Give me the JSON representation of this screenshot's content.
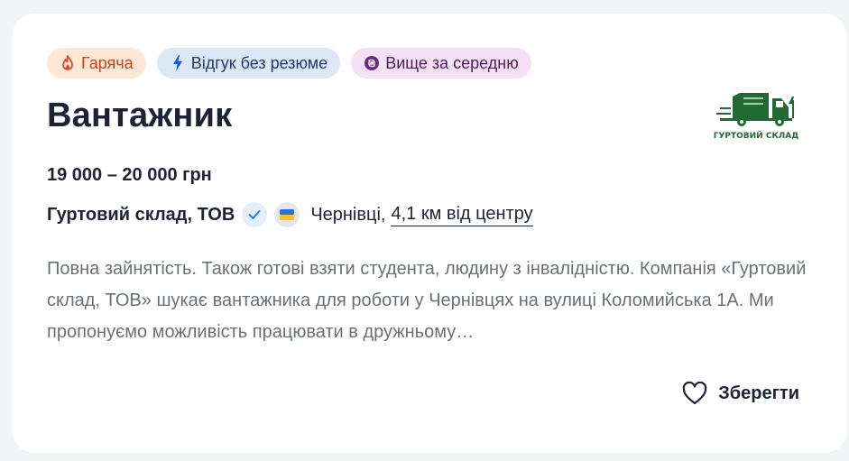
{
  "tags": [
    {
      "label": "Гаряча",
      "icon": "flame-icon"
    },
    {
      "label": "Відгук без резюме",
      "icon": "lightning-icon"
    },
    {
      "label": "Вище за середню",
      "icon": "hryvnia-coin-icon"
    }
  ],
  "vacancy": {
    "title": "Вантажник",
    "salary": "19 000 – 20 000 грн",
    "company": "Гуртовий склад, ТОВ",
    "city": "Чернівці,",
    "distance": "4,1 км від центру",
    "description": "Повна зайнятість. Також готові взяти студента, людину з інвалідністю. Компанія «Гуртовий склад, ТОВ» шукає вантажника для роботи у Чернівцях на вулиці Коломийська 1А. Ми пропонуємо можливість працювати в дружньому…"
  },
  "logo": {
    "text": "ГУРТОВИЙ СКЛАД",
    "color": "#1f6b32"
  },
  "actions": {
    "save_label": "Зберегти"
  },
  "colors": {
    "hot": "#d64016",
    "verified": "#1e88e5",
    "text": "#1b2336",
    "muted": "#6b6f78"
  }
}
